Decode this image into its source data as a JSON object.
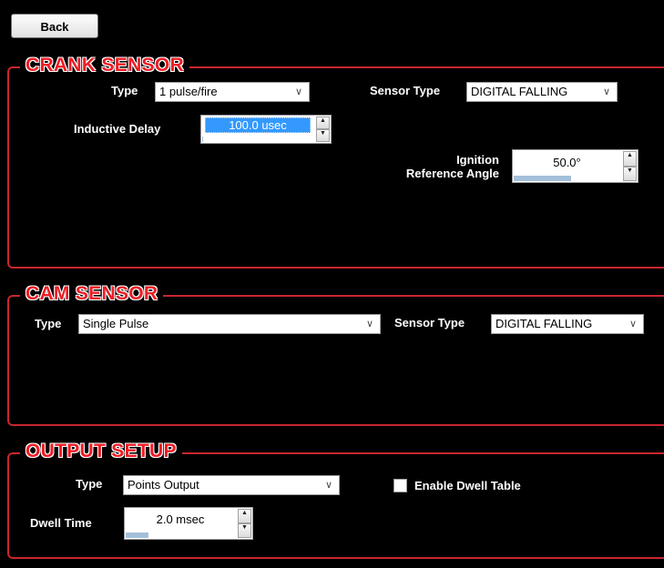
{
  "toolbar": {
    "back_label": "Back"
  },
  "crank": {
    "title": "CRANK SENSOR",
    "type_label": "Type",
    "type_value": "1 pulse/fire",
    "sensor_type_label": "Sensor Type",
    "sensor_type_value": "DIGITAL FALLING",
    "inductive_delay_label": "Inductive Delay",
    "inductive_delay_value": "100.0 usec",
    "inductive_delay_level": 0.02,
    "ignition_label_line1": "Ignition",
    "ignition_label_line2": "Reference Angle",
    "ignition_value": "50.0°",
    "ignition_level": 0.55
  },
  "cam": {
    "title": "CAM SENSOR",
    "type_label": "Type",
    "type_value": "Single Pulse",
    "sensor_type_label": "Sensor Type",
    "sensor_type_value": "DIGITAL FALLING"
  },
  "output": {
    "title": "OUTPUT SETUP",
    "type_label": "Type",
    "type_value": "Points Output",
    "enable_dwell_label": "Enable Dwell Table",
    "enable_dwell_checked": false,
    "dwell_time_label": "Dwell Time",
    "dwell_time_value": "2.0 msec",
    "dwell_time_level": 0.22
  },
  "icons": {
    "dropdown": "chevron-down-icon",
    "spin_up": "arrow-up-icon",
    "spin_down": "arrow-down-icon"
  },
  "colors": {
    "background": "#000000",
    "panel_border": "#c8262e",
    "title_red": "#ee1c24",
    "selection_blue": "#3399ff",
    "level_bar": "#a3bfd9"
  }
}
